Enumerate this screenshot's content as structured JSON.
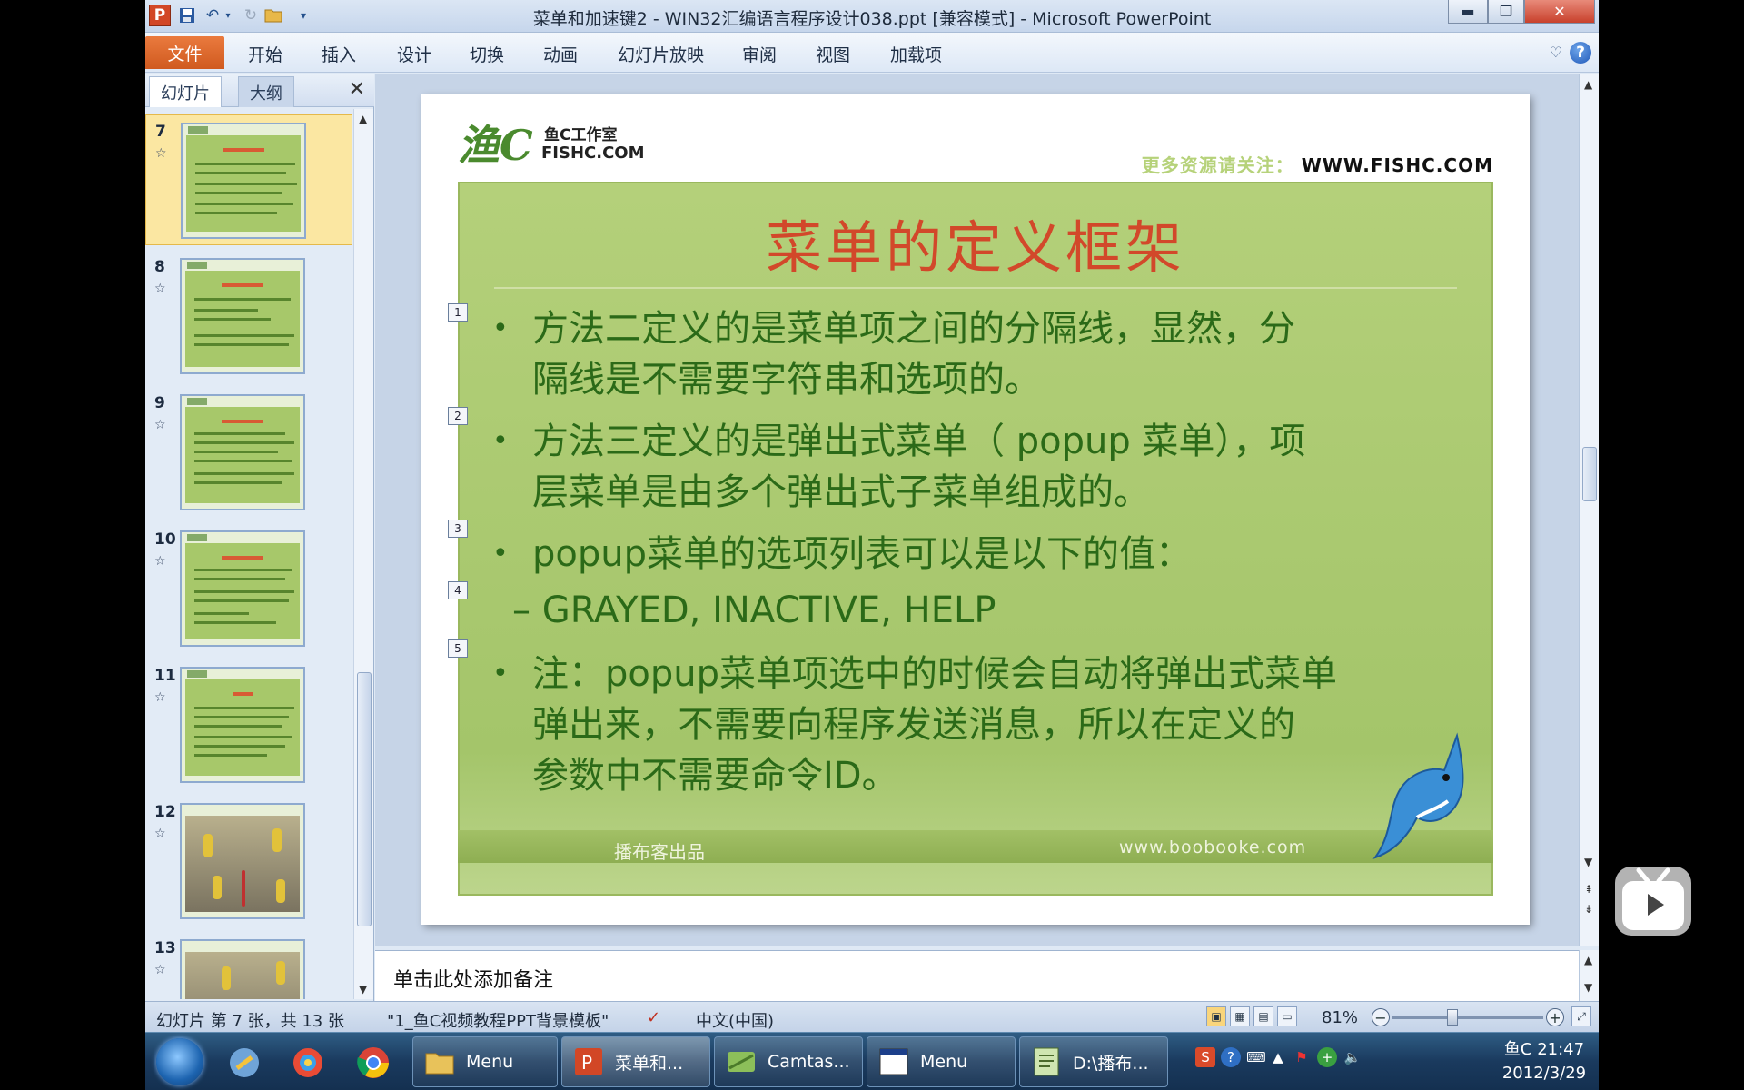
{
  "window": {
    "title": "菜单和加速键2 - WIN32汇编语言程序设计038.ppt [兼容模式]  -  Microsoft PowerPoint",
    "app_icon": "P"
  },
  "quick_access": [
    "save-icon",
    "undo-icon",
    "redo-icon",
    "open-icon",
    "customize-icon"
  ],
  "ribbon": {
    "file_tab": "文件",
    "tabs": [
      "开始",
      "插入",
      "设计",
      "切换",
      "动画",
      "幻灯片放映",
      "审阅",
      "视图",
      "加载项"
    ]
  },
  "left_pane": {
    "tab_slides": "幻灯片",
    "tab_outline": "大纲",
    "thumbnails": [
      {
        "num": "7",
        "selected": true
      },
      {
        "num": "8"
      },
      {
        "num": "9"
      },
      {
        "num": "10"
      },
      {
        "num": "11"
      },
      {
        "num": "12"
      },
      {
        "num": "13"
      }
    ]
  },
  "slide": {
    "logo_script": "渔C",
    "logo_studio": "鱼C工作室",
    "logo_fishc": "FISHC.COM",
    "top_right_prefix": "更多资源请关注：",
    "top_right_url": "WWW.FISHC.COM",
    "title": "菜单的定义框架",
    "bullets": [
      {
        "marker": "1",
        "text": "方法二定义的是菜单项之间的分隔线，显然，分\n隔线是不需要字符串和选项的。"
      },
      {
        "marker": "2",
        "text": "方法三定义的是弹出式菜单（ popup 菜单），项\n层菜单是由多个弹出式子菜单组成的。"
      },
      {
        "marker": "3",
        "text": "popup菜单的选项列表可以是以下的值："
      },
      {
        "marker": "4",
        "text": "– GRAYED, INACTIVE, HELP"
      },
      {
        "marker": "5",
        "text": "注：popup菜单项选中的时候会自动将弹出式菜单\n弹出来，不需要向程序发送消息，所以在定义的\n参数中不需要命令ID。"
      }
    ],
    "footer_left": "播布客出品",
    "footer_right": "www.boobooke.com"
  },
  "notes": {
    "placeholder": "单击此处添加备注"
  },
  "status": {
    "slide_info": "幻灯片 第 7 张，共 13 张",
    "theme": "\"1_鱼C视频教程PPT背景模板\"",
    "language": "中文(中国)",
    "zoom": "81%"
  },
  "taskbar": {
    "tasks": [
      {
        "label": "Menu",
        "icon": "folder-icon"
      },
      {
        "label": "菜单和...",
        "icon": "powerpoint-icon",
        "active": true
      },
      {
        "label": "Camtas...",
        "icon": "camtasia-icon"
      },
      {
        "label": "Menu",
        "icon": "window-icon"
      },
      {
        "label": "D:\\播布...",
        "icon": "notepad-icon"
      }
    ],
    "clock_time": "鱼C 21:47",
    "clock_date": "2012/3/29"
  },
  "colors": {
    "slide_title": "#d2482a",
    "slide_text": "#2b6a18",
    "slide_bg": "#a8c86c",
    "file_tab": "#d9612a",
    "taskbar": "#1a3a5e"
  }
}
